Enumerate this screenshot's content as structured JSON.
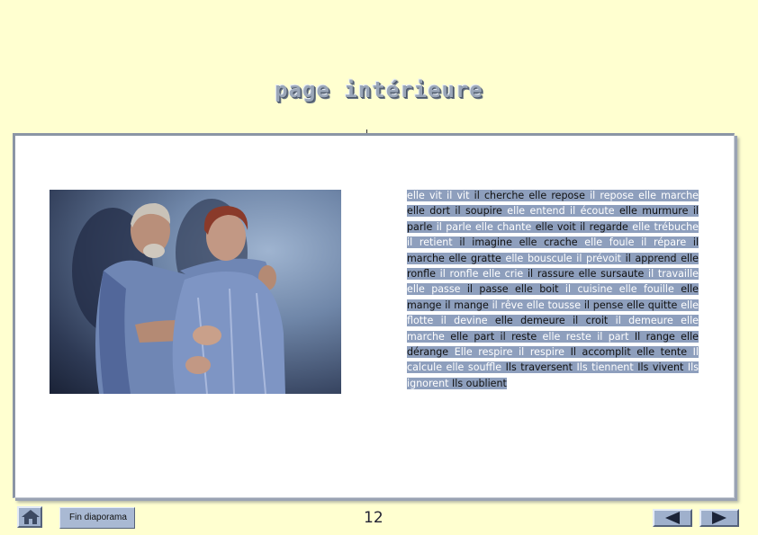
{
  "page": {
    "title": "page intérieure",
    "page_number": "12"
  },
  "photo": {
    "alt": "photograph of an elderly couple"
  },
  "poem": {
    "segments": [
      {
        "t": "elle vit il vit ",
        "d": false
      },
      {
        "t": "il cherche elle repose ",
        "d": true
      },
      {
        "t": "il repose elle marche ",
        "d": false
      },
      {
        "t": "elle dort il soupire ",
        "d": true
      },
      {
        "t": "elle entend il écoute ",
        "d": false
      },
      {
        "t": "elle murmure il parle ",
        "d": true
      },
      {
        "t": "il parle elle chante ",
        "d": false
      },
      {
        "t": "elle voit il regarde ",
        "d": true
      },
      {
        "t": "elle trébuche il retient ",
        "d": false
      },
      {
        "t": "il imagine elle crache ",
        "d": true
      },
      {
        "t": "elle foule il répare ",
        "d": false
      },
      {
        "t": "il marche elle gratte ",
        "d": true
      },
      {
        "t": "elle bouscule il prévoit ",
        "d": false
      },
      {
        "t": "il apprend elle ronfle ",
        "d": true
      },
      {
        "t": "il ronfle elle crie ",
        "d": false
      },
      {
        "t": "il rassure elle sursaute ",
        "d": true
      },
      {
        "t": "il travaille elle passe ",
        "d": false
      },
      {
        "t": "il passe elle boit ",
        "d": true
      },
      {
        "t": "il cuisine elle fouille ",
        "d": false
      },
      {
        "t": "elle mange il mange ",
        "d": true
      },
      {
        "t": "il rêve elle tousse ",
        "d": false
      },
      {
        "t": "il pense elle quitte ",
        "d": true
      },
      {
        "t": "elle flotte il devine ",
        "d": false
      },
      {
        "t": "elle demeure il croit ",
        "d": true
      },
      {
        "t": "il demeure elle marche ",
        "d": false
      },
      {
        "t": "elle part il reste ",
        "d": true
      },
      {
        "t": "elle reste il part ",
        "d": false
      },
      {
        "t": "Il range elle dérange ",
        "d": true
      },
      {
        "t": "Elle respire il respire ",
        "d": false
      },
      {
        "t": "Il accomplit elle tente ",
        "d": true
      },
      {
        "t": "Il calcule elle souffle ",
        "d": false
      },
      {
        "t": "Ils traversent ",
        "d": true
      },
      {
        "t": "Ils tiennent ",
        "d": false
      },
      {
        "t": "Ils vivent ",
        "d": true
      },
      {
        "t": "Ils ignorent ",
        "d": false
      },
      {
        "t": "Ils oublient ",
        "d": true
      }
    ]
  },
  "footer": {
    "home_icon": "home-icon",
    "fin_label": "Fin diaporama",
    "prev_icon": "triangle-left-icon",
    "next_icon": "triangle-right-icon"
  },
  "colors": {
    "background": "#ffffd0",
    "highlight": "#8e9fbd",
    "button": "#9fb0cc"
  }
}
